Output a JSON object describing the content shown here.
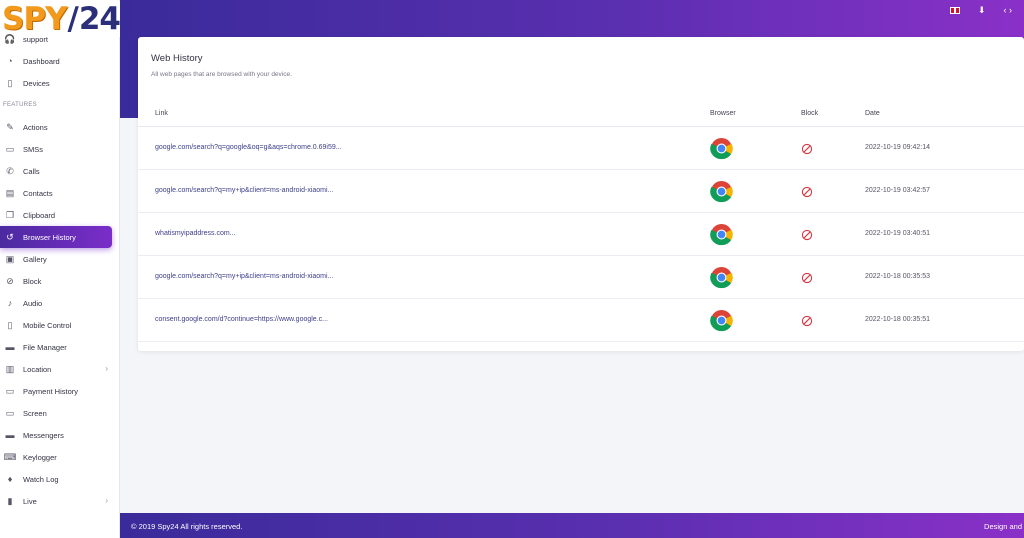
{
  "brand": {
    "spy": "SPY",
    "slash": "/",
    "num": "24",
    "reg": "®"
  },
  "sidebar": {
    "items": [
      {
        "label": "support",
        "icon": "headset-icon",
        "glyph": "🎧"
      },
      {
        "label": "Dashboard",
        "icon": "dashboard-icon",
        "glyph": "◔"
      },
      {
        "label": "Devices",
        "icon": "phone-icon",
        "glyph": "▯"
      }
    ],
    "section_label": "FEATURES",
    "features": [
      {
        "label": "Actions",
        "icon": "actions-icon",
        "glyph": "✎"
      },
      {
        "label": "SMSs",
        "icon": "sms-icon",
        "glyph": "▭"
      },
      {
        "label": "Calls",
        "icon": "call-icon",
        "glyph": "✆"
      },
      {
        "label": "Contacts",
        "icon": "contacts-icon",
        "glyph": "▤"
      },
      {
        "label": "Clipboard",
        "icon": "clipboard-icon",
        "glyph": "❐"
      },
      {
        "label": "Browser History",
        "icon": "history-icon",
        "glyph": "↺",
        "active": true
      },
      {
        "label": "Gallery",
        "icon": "gallery-icon",
        "glyph": "▣"
      },
      {
        "label": "Block",
        "icon": "block-icon",
        "glyph": "⊘"
      },
      {
        "label": "Audio",
        "icon": "microphone-icon",
        "glyph": "♪"
      },
      {
        "label": "Mobile Control",
        "icon": "mobile-icon",
        "glyph": "▯"
      },
      {
        "label": "File Manager",
        "icon": "file-icon",
        "glyph": "▬"
      },
      {
        "label": "Location",
        "icon": "map-icon",
        "glyph": "▥",
        "chevron": "›"
      },
      {
        "label": "Payment History",
        "icon": "payment-icon",
        "glyph": "▭"
      },
      {
        "label": "Screen",
        "icon": "screen-icon",
        "glyph": "▭"
      },
      {
        "label": "Messengers",
        "icon": "messenger-icon",
        "glyph": "▬"
      },
      {
        "label": "Keylogger",
        "icon": "keyboard-icon",
        "glyph": "⌨"
      },
      {
        "label": "Watch Log",
        "icon": "bell-icon",
        "glyph": "♦"
      },
      {
        "label": "Live",
        "icon": "live-icon",
        "glyph": "▮",
        "chevron": "›"
      }
    ]
  },
  "header": {
    "icons": [
      {
        "name": "language-flag-icon",
        "glyph": ""
      },
      {
        "name": "download-icon",
        "glyph": "⬇"
      },
      {
        "name": "code-icon",
        "glyph": "‹ ›"
      }
    ]
  },
  "card": {
    "title": "Web History",
    "subtitle": "All web pages that are browsed with your device.",
    "columns": {
      "link": "Link",
      "browser": "Browser",
      "block": "Block",
      "date": "Date"
    },
    "rows": [
      {
        "link": "google.com/search?q=google&oq=g&aqs=chrome.0.69i59...",
        "browser": "chrome-icon",
        "date": "2022-10-19 09:42:14"
      },
      {
        "link": "google.com/search?q=my+ip&client=ms-android-xiaomi...",
        "browser": "chrome-icon",
        "date": "2022-10-19 03:42:57"
      },
      {
        "link": "whatismyipaddress.com...",
        "browser": "chrome-icon",
        "date": "2022-10-19 03:40:51"
      },
      {
        "link": "google.com/search?q=my+ip&client=ms-android-xiaomi...",
        "browser": "chrome-icon",
        "date": "2022-10-18 00:35:53"
      },
      {
        "link": "consent.google.com/d?continue=https://www.google.c...",
        "browser": "chrome-icon",
        "date": "2022-10-18 00:35:51"
      }
    ]
  },
  "footer": {
    "copyright": "© 2019 Spy24 All rights reserved.",
    "design": "Design and"
  },
  "colors": {
    "accent_start": "#3a2b9a",
    "accent_end": "#8a30c8",
    "brand_orange": "#f39a1c",
    "brand_navy": "#2b2f7a",
    "block_red": "#d9353f"
  }
}
